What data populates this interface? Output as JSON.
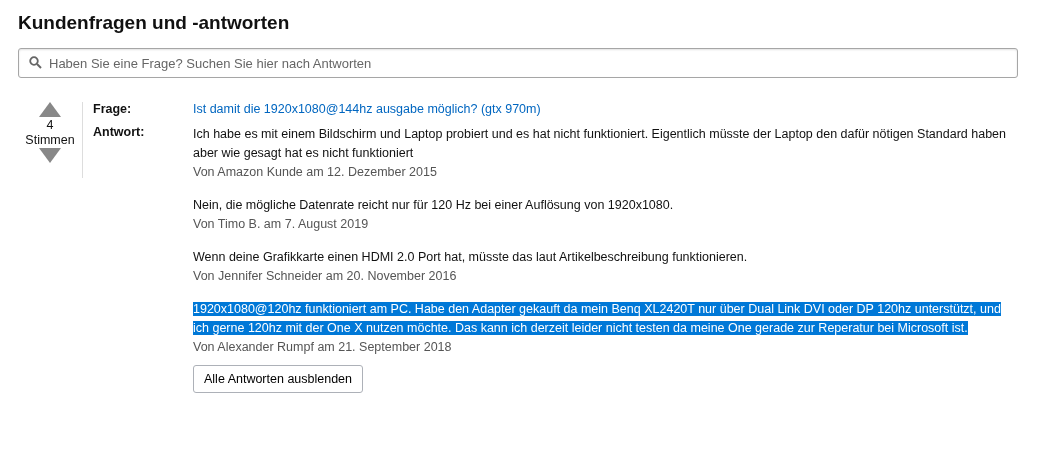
{
  "heading": "Kundenfragen und -antworten",
  "search": {
    "placeholder": "Haben Sie eine Frage? Suchen Sie hier nach Antworten"
  },
  "question": {
    "votes": "4",
    "votes_label": "Stimmen",
    "question_label": "Frage:",
    "question_text": "Ist damit die 1920x1080@144hz ausgabe möglich? (gtx 970m)",
    "answer_label": "Antwort:",
    "answers": [
      {
        "text": "Ich habe es mit einem Bildschirm und Laptop probiert und es hat nicht funktioniert. Eigentlich müsste der Laptop den dafür nötigen Standard haben aber wie gesagt hat es nicht funktioniert",
        "byline": "Von Amazon Kunde am 12. Dezember 2015",
        "selected": false
      },
      {
        "text": "Nein, die mögliche Datenrate reicht nur für 120 Hz bei einer Auflösung von 1920x1080.",
        "byline": "Von Timo B. am 7. August 2019",
        "selected": false
      },
      {
        "text": "Wenn deine Grafikkarte einen HDMI 2.0 Port hat, müsste das laut Artikelbeschreibung funktionieren.",
        "byline": "Von Jennifer Schneider am 20. November 2016",
        "selected": false
      },
      {
        "text": "1920x1080@120hz funktioniert am PC. Habe den Adapter gekauft da mein Benq XL2420T nur über Dual Link DVI oder DP 120hz unterstützt, und ich gerne 120hz mit der One X nutzen möchte. Das kann ich derzeit leider nicht testen da meine One gerade zur Reperatur bei Microsoft ist.",
        "byline": "Von Alexander Rumpf am 21. September 2018",
        "selected": true
      }
    ],
    "collapse_button": "Alle Antworten ausblenden"
  }
}
